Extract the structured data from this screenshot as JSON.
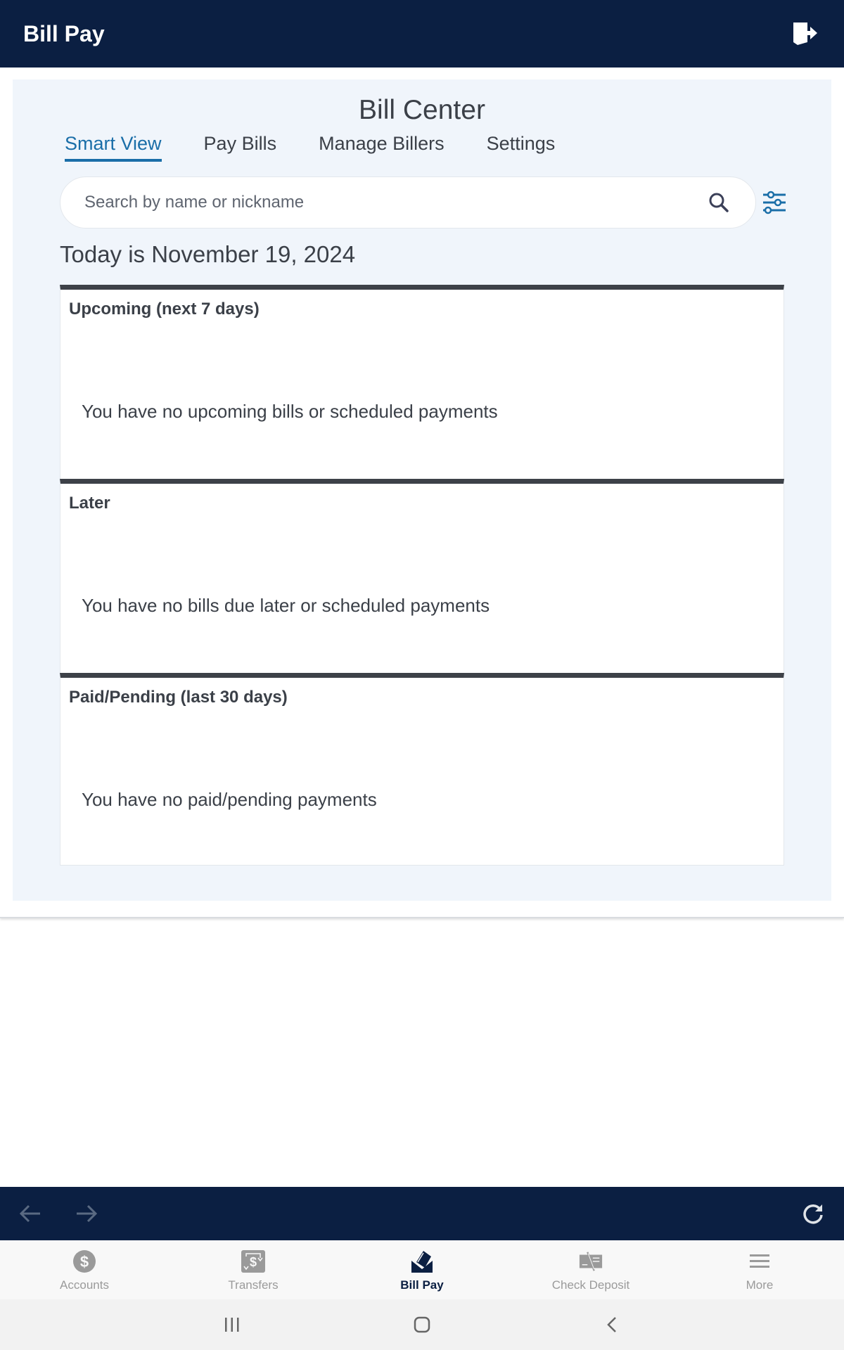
{
  "app_bar": {
    "title": "Bill Pay",
    "logout_icon": "logout-door-icon"
  },
  "bill_center": {
    "title": "Bill Center",
    "tabs": [
      {
        "label": "Smart View",
        "active": true
      },
      {
        "label": "Pay Bills",
        "active": false
      },
      {
        "label": "Manage Billers",
        "active": false
      },
      {
        "label": "Settings",
        "active": false
      }
    ],
    "search": {
      "placeholder": "Search by name or nickname",
      "value": ""
    },
    "today": "Today is November 19, 2024",
    "sections": [
      {
        "title": "Upcoming (next 7 days)",
        "message": "You have no upcoming bills or scheduled payments"
      },
      {
        "title": "Later",
        "message": "You have no bills due later or scheduled payments"
      },
      {
        "title": "Paid/Pending (last 30 days)",
        "message": "You have no paid/pending payments"
      }
    ]
  },
  "browser_nav": {
    "back_icon": "arrow-left-icon",
    "forward_icon": "arrow-right-icon",
    "refresh_icon": "refresh-icon"
  },
  "tabbar": {
    "items": [
      {
        "label": "Accounts",
        "icon": "dollar-circle-icon",
        "active": false
      },
      {
        "label": "Transfers",
        "icon": "transfer-icon",
        "active": false
      },
      {
        "label": "Bill Pay",
        "icon": "bill-envelope-icon",
        "active": true
      },
      {
        "label": "Check Deposit",
        "icon": "check-deposit-icon",
        "active": false
      },
      {
        "label": "More",
        "icon": "menu-icon",
        "active": false
      }
    ]
  },
  "colors": {
    "header": "#0b1f42",
    "accent": "#1a6ea8",
    "panel": "#f0f5fb",
    "text": "#3b4048"
  }
}
